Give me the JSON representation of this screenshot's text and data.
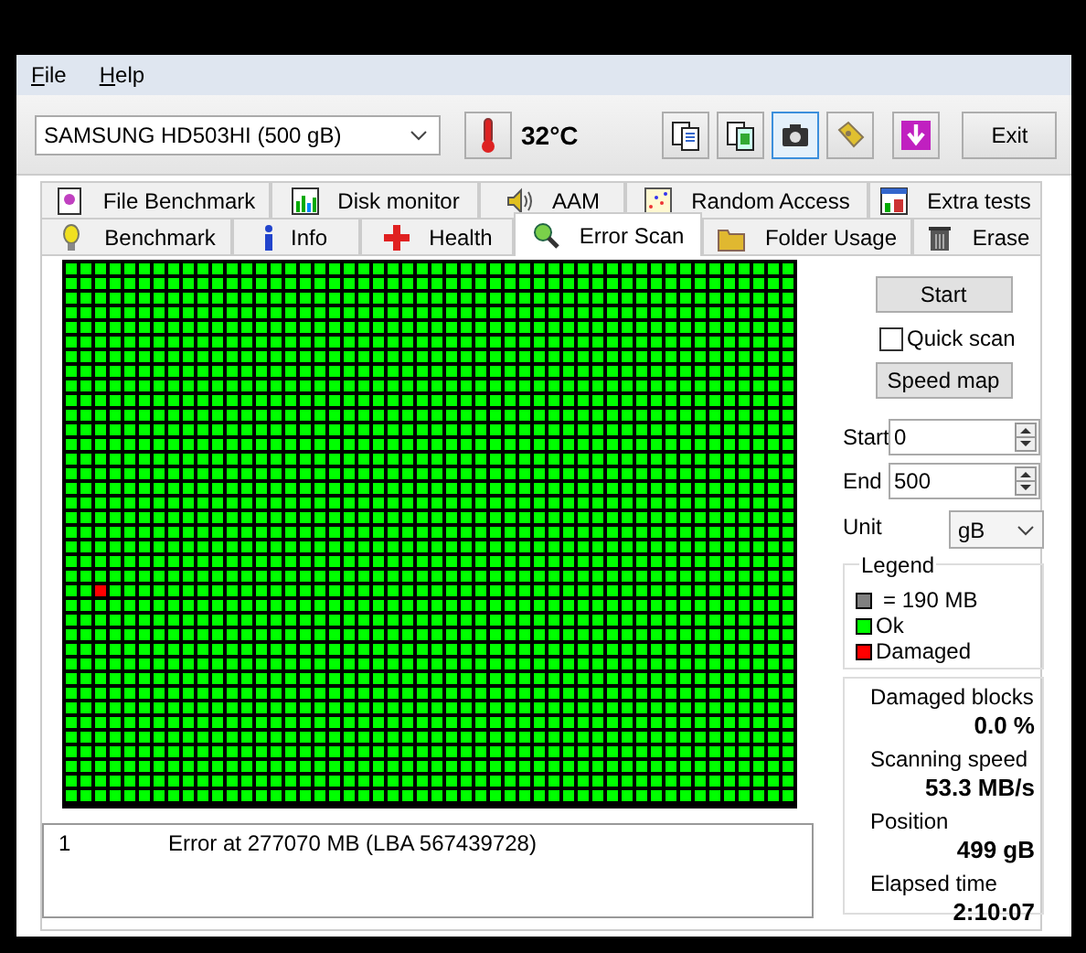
{
  "menu": [
    {
      "label": "File"
    },
    {
      "label": "Help"
    }
  ],
  "toolbar": {
    "drive": "SAMSUNG HD503HI (500 gB)",
    "temperature": "32°C",
    "tool_buttons": [
      {
        "selected": false
      },
      {
        "selected": false
      },
      {
        "selected": true
      },
      {
        "selected": false
      },
      {
        "selected": false
      }
    ],
    "exit": "Exit"
  },
  "tabs_top": [
    {
      "label": "File Benchmark",
      "selected": false
    },
    {
      "label": "Disk monitor",
      "selected": false
    },
    {
      "label": "AAM",
      "selected": false
    },
    {
      "label": "Random Access",
      "selected": false
    },
    {
      "label": "Extra tests",
      "selected": false
    }
  ],
  "tabs_bottom": [
    {
      "label": "Benchmark",
      "selected": false
    },
    {
      "label": "Info",
      "selected": false
    },
    {
      "label": "Health",
      "selected": false
    },
    {
      "label": "Error Scan",
      "selected": true
    },
    {
      "label": "Folder Usage",
      "selected": false
    },
    {
      "label": "Erase",
      "selected": false
    }
  ],
  "controls": {
    "start_button": "Start",
    "quick_scan": {
      "label": "Quick scan",
      "checked": false
    },
    "speed_map_button": "Speed map",
    "start": {
      "label": "Start",
      "value": "0"
    },
    "end": {
      "label": "End",
      "value": "500"
    },
    "unit": {
      "label": "Unit",
      "value": "gB"
    }
  },
  "legend": {
    "title": "Legend",
    "items": [
      {
        "kind": "size",
        "label": "= 190 MB",
        "color": "#808080"
      },
      {
        "kind": "ok",
        "label": "Ok",
        "color": "#00ff00"
      },
      {
        "kind": "damaged",
        "label": "Damaged",
        "color": "#ff0000"
      }
    ]
  },
  "stats": [
    {
      "label": "Damaged blocks",
      "value": "0.0 %"
    },
    {
      "label": "Scanning speed",
      "value": "53.3 MB/s"
    },
    {
      "label": "Position",
      "value": "499 gB"
    },
    {
      "label": "Elapsed time",
      "value": "2:10:07"
    }
  ],
  "log": [
    {
      "number": "1",
      "message": "Error at 277070 MB (LBA 567439728)"
    }
  ]
}
